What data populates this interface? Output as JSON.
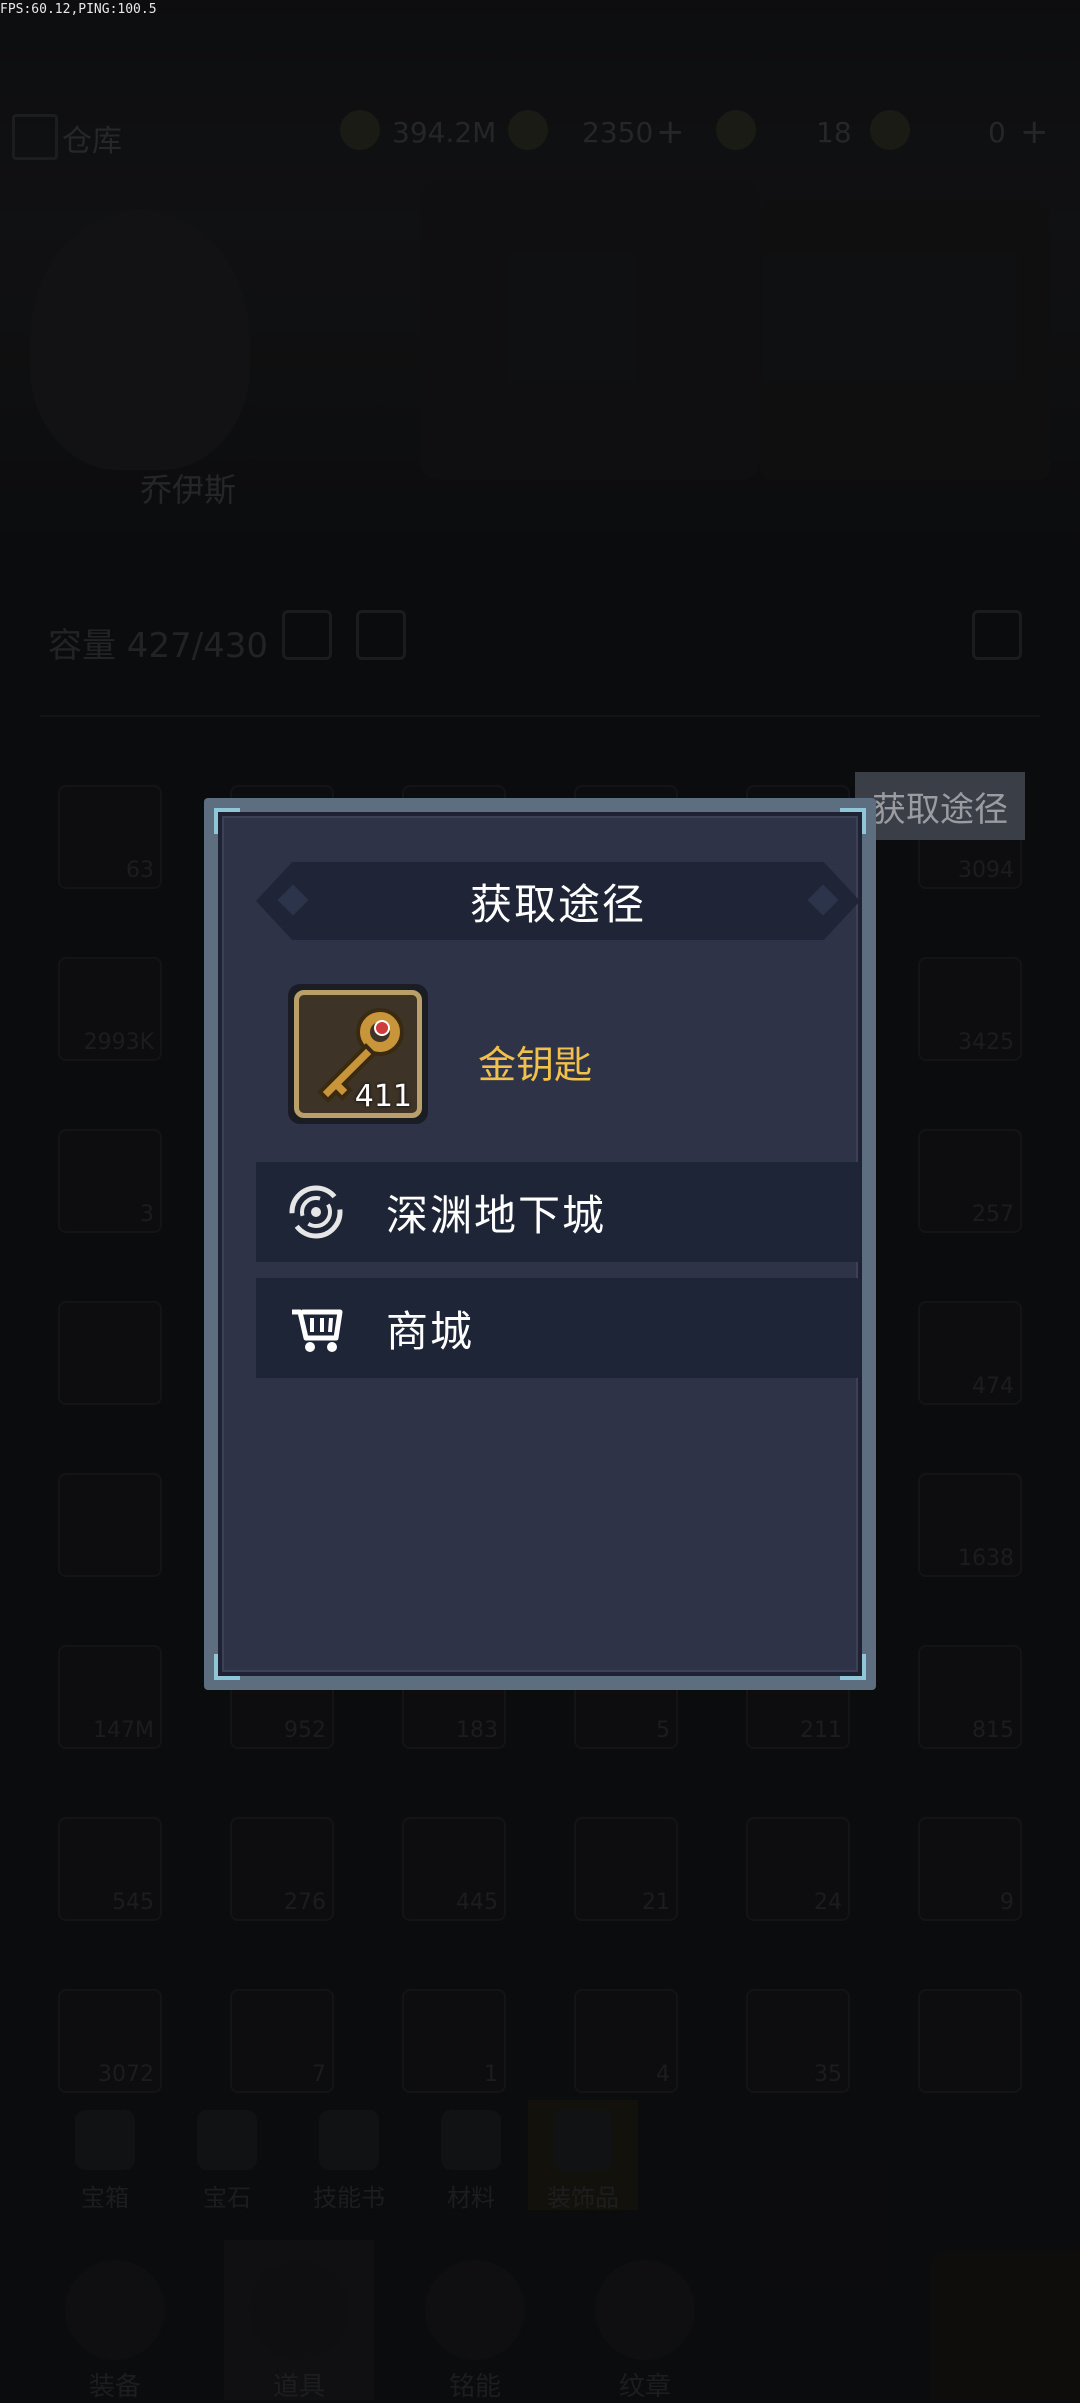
{
  "debug": {
    "fps_text": "FPS:60.12,PING:100.5"
  },
  "background": {
    "header_title": "仓库",
    "resources": [
      {
        "name": "gold",
        "value": "394.2M"
      },
      {
        "name": "diamond",
        "value": "2350"
      },
      {
        "name": "energy",
        "value": "18"
      },
      {
        "name": "ticket",
        "value": "0"
      }
    ],
    "hero_name": "乔伊斯",
    "capacity": "容量 427/430",
    "side_tab": "获取途径",
    "slot_counts": [
      "63",
      "",
      "",
      "",
      "",
      "3094",
      "2993K",
      "",
      "",
      "",
      "",
      "3425",
      "3",
      "",
      "",
      "",
      "",
      "257",
      "",
      "",
      "",
      "",
      "",
      "474",
      "",
      "",
      "",
      "",
      "",
      "1638",
      "147M",
      "952",
      "183",
      "5",
      "211",
      "815",
      "545",
      "276",
      "445",
      "21",
      "24",
      "9",
      "3072",
      "7",
      "1",
      "4",
      "35",
      ""
    ],
    "category_tabs": [
      "宝箱",
      "宝石",
      "技能书",
      "材料",
      "装饰品"
    ],
    "bottom_nav": [
      "装备",
      "道具",
      "铭能",
      "纹章"
    ]
  },
  "dialog": {
    "title": "获取途径",
    "item": {
      "name": "金钥匙",
      "count": "411",
      "icon": "gold-key-icon"
    },
    "sources": [
      {
        "label": "深渊地下城",
        "icon": "vortex-icon"
      },
      {
        "label": "商城",
        "icon": "shopping-cart-icon"
      }
    ]
  },
  "colors": {
    "dialog_bg": "#2e3347",
    "row_bg": "#1e2536",
    "item_name": "#f0c14b",
    "accent_corner": "#8fc7d8"
  }
}
